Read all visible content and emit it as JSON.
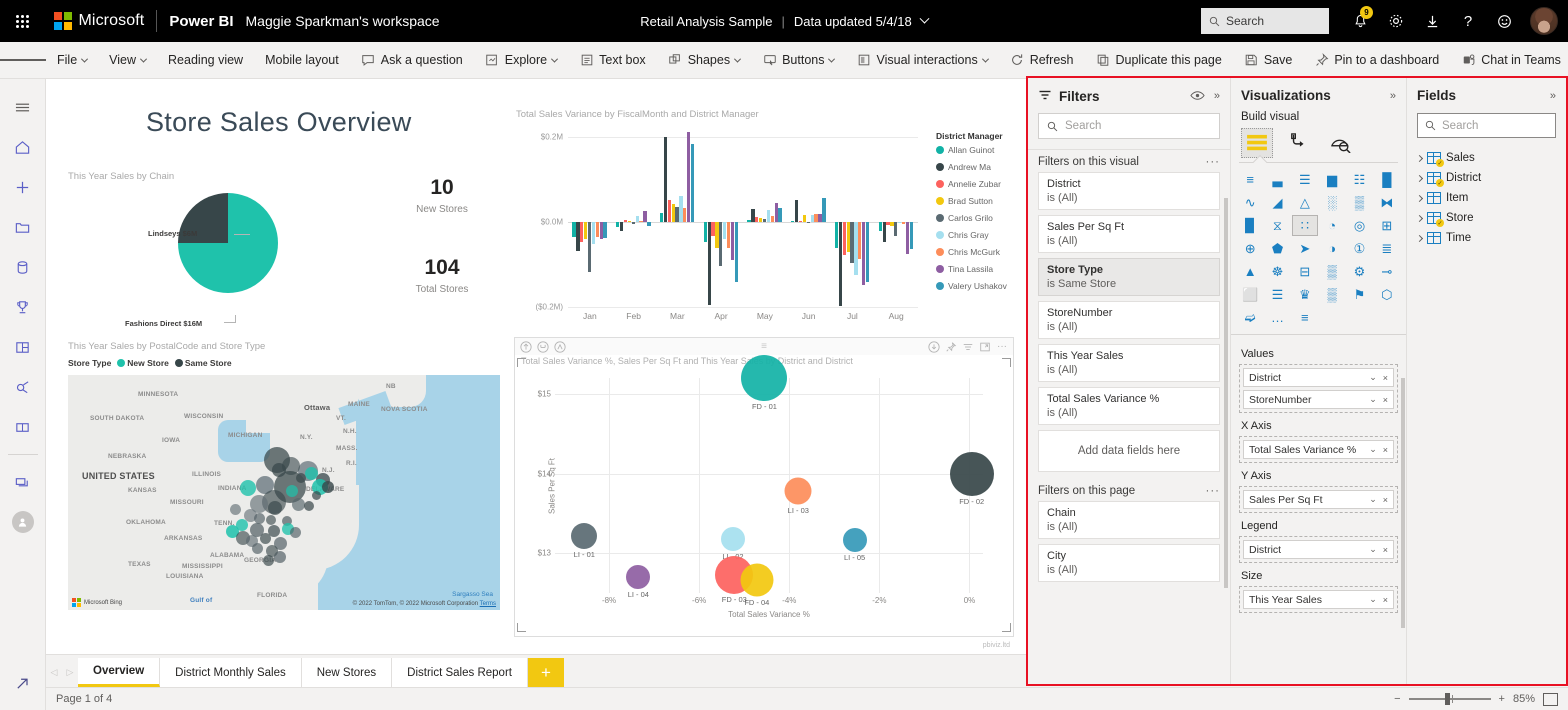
{
  "topbar": {
    "waffle": "app-launcher",
    "microsoft": "Microsoft",
    "product": "Power BI",
    "workspace": "Maggie Sparkman's workspace",
    "report_name": "Retail Analysis Sample",
    "separator": "|",
    "data_updated": "Data updated 5/4/18",
    "search_placeholder": "Search",
    "notification_count": "9",
    "icons": [
      "notifications-icon",
      "settings-icon",
      "download-icon",
      "help-icon",
      "feedback-icon",
      "avatar"
    ]
  },
  "commandbar": {
    "items": [
      {
        "label": "File",
        "icon": "",
        "caret": true
      },
      {
        "label": "View",
        "icon": "",
        "caret": true
      },
      {
        "label": "Reading view",
        "icon": "",
        "caret": false
      },
      {
        "label": "Mobile layout",
        "icon": "",
        "caret": false
      }
    ],
    "right_items": [
      {
        "label": "Ask a question",
        "icon": "chat-icon",
        "caret": false
      },
      {
        "label": "Explore",
        "icon": "explore-icon",
        "caret": true
      },
      {
        "label": "Text box",
        "icon": "textbox-icon",
        "caret": false
      },
      {
        "label": "Shapes",
        "icon": "shapes-icon",
        "caret": true
      },
      {
        "label": "Buttons",
        "icon": "buttons-icon",
        "caret": true
      },
      {
        "label": "Visual interactions",
        "icon": "interactions-icon",
        "caret": true
      },
      {
        "label": "Refresh",
        "icon": "refresh-icon",
        "caret": false
      },
      {
        "label": "Duplicate this page",
        "icon": "duplicate-icon",
        "caret": false
      },
      {
        "label": "Save",
        "icon": "save-icon",
        "caret": false
      },
      {
        "label": "Pin to a dashboard",
        "icon": "pin-icon",
        "caret": false
      },
      {
        "label": "Chat in Teams",
        "icon": "teams-icon",
        "caret": false
      },
      {
        "label": "···",
        "icon": "",
        "caret": false
      }
    ]
  },
  "rail": {
    "items": [
      "hamburger-icon",
      "home-icon",
      "create-icon",
      "browse-icon",
      "datahub-icon",
      "metrics-icon",
      "apps-icon",
      "deployment-pipelines-icon",
      "learn-icon",
      "workspaces-icon",
      "my-workspace-icon"
    ],
    "bottom": "open-in-new-icon"
  },
  "report": {
    "title": "Store Sales Overview",
    "pie": {
      "title": "This Year Sales by Chain",
      "labels": [
        "Lindseys $6M",
        "Fashions Direct $16M"
      ],
      "colors": [
        "#374649",
        "#1fc2ab"
      ]
    },
    "kpis": [
      {
        "value": "10",
        "label": "New Stores"
      },
      {
        "value": "104",
        "label": "Total Stores"
      }
    ],
    "map": {
      "title": "This Year Sales by PostalCode and Store Type",
      "legend_title": "Store Type",
      "legend": [
        {
          "label": "New Store",
          "color": "#1fc2ab"
        },
        {
          "label": "Same Store",
          "color": "#374649"
        }
      ],
      "country_label": "UNITED STATES",
      "state_labels": [
        "MINNESOTA",
        "WISCONSIN",
        "SOUTH DAKOTA",
        "MICHIGAN",
        "IOWA",
        "NEBRASKA",
        "ILLINOIS",
        "INDIANA",
        "KANSAS",
        "MISSOURI",
        "OKLAHOMA",
        "ARKANSAS",
        "TENN.",
        "ALABAMA",
        "MISSISSIPPI",
        "LOUISIANA",
        "TEXAS",
        "GEORGIA",
        "FLORIDA",
        "Ottawa",
        "MAINE",
        "NOVA SCOTIA",
        "NB",
        "VT.",
        "N.H.",
        "N.Y.",
        "MASS.",
        "R.I.",
        "N.J.",
        "DELAWARE",
        "Gulf of"
      ],
      "sea_label": "Sargasso Sea",
      "provider": "Microsoft Bing",
      "attribution": "© 2022 TomTom, © 2022 Microsoft Corporation",
      "terms": "Terms"
    }
  },
  "chart_data": [
    {
      "type": "bar",
      "title": "Total Sales Variance by FiscalMonth and District Manager",
      "xlabel": "",
      "ylabel": "",
      "categories": [
        "Jan",
        "Feb",
        "Mar",
        "Apr",
        "May",
        "Jun",
        "Jul",
        "Aug"
      ],
      "ytick_labels": [
        "$0.2M",
        "$0.0M",
        "($0.2M)"
      ],
      "ylim": [
        -0.2,
        0.2
      ],
      "legend_title": "District Manager",
      "legend_position": "right",
      "series": [
        {
          "name": "Allan Guinot",
          "color": "#12b2a6",
          "values": [
            -0.035,
            -0.012,
            0.022,
            -0.048,
            0.004,
            0.003,
            -0.06,
            -0.022
          ]
        },
        {
          "name": "Andrew Ma",
          "color": "#374649",
          "values": [
            -0.068,
            -0.02,
            0.2,
            -0.196,
            0.03,
            0.052,
            -0.197,
            -0.048
          ]
        },
        {
          "name": "Annelie Zubar",
          "color": "#fd625e",
          "values": [
            -0.046,
            0.005,
            0.052,
            -0.032,
            0.012,
            0.001,
            -0.078,
            -0.007
          ]
        },
        {
          "name": "Brad Sutton",
          "color": "#f2c80f",
          "values": [
            -0.04,
            0.001,
            0.042,
            -0.06,
            0.01,
            0.016,
            -0.07,
            -0.01
          ]
        },
        {
          "name": "Carlos Grilo",
          "color": "#5a6a72",
          "values": [
            -0.118,
            -0.004,
            0.036,
            -0.104,
            0.006,
            -0.003,
            -0.096,
            -0.033
          ]
        },
        {
          "name": "Chris Gray",
          "color": "#a5dfef",
          "values": [
            -0.052,
            0.014,
            0.062,
            -0.04,
            0.028,
            0.016,
            -0.124,
            -0.003
          ]
        },
        {
          "name": "Chris McGurk",
          "color": "#fd8d5a",
          "values": [
            -0.036,
            0.002,
            0.034,
            -0.062,
            0.014,
            0.018,
            -0.086,
            -0.004
          ]
        },
        {
          "name": "Tina Lassila",
          "color": "#8e5ea2",
          "values": [
            -0.04,
            0.026,
            0.212,
            -0.09,
            0.044,
            0.02,
            -0.148,
            -0.076
          ]
        },
        {
          "name": "Valery Ushakov",
          "color": "#3599b8",
          "values": [
            -0.038,
            -0.01,
            0.184,
            -0.142,
            0.032,
            0.056,
            -0.14,
            -0.064
          ]
        }
      ]
    },
    {
      "type": "scatter",
      "title": "Total Sales Variance %, Sales Per Sq Ft and This Year Sales by District and District",
      "xlabel": "Total Sales Variance %",
      "ylabel": "Sales Per Sq Ft",
      "xtick_labels": [
        "-8%",
        "-6%",
        "-4%",
        "-2%",
        "0%"
      ],
      "ytick_labels": [
        "$15",
        "$14",
        "$13"
      ],
      "xlim": [
        -9.2,
        0.3
      ],
      "ylim": [
        12.5,
        15.2
      ],
      "points": [
        {
          "label": "FD - 01",
          "x": -4.55,
          "y": 15.2,
          "size": 46,
          "color": "#12b2a6"
        },
        {
          "label": "FD - 02",
          "x": 0.05,
          "y": 14.0,
          "size": 44,
          "color": "#374649"
        },
        {
          "label": "LI - 03",
          "x": -3.8,
          "y": 13.78,
          "size": 27,
          "color": "#fd8d5a"
        },
        {
          "label": "LI - 01",
          "x": -8.55,
          "y": 13.22,
          "size": 26,
          "color": "#5a6a72"
        },
        {
          "label": "LI - 02",
          "x": -5.25,
          "y": 13.18,
          "size": 24,
          "color": "#a5dfef"
        },
        {
          "label": "LI - 05",
          "x": -2.55,
          "y": 13.16,
          "size": 24,
          "color": "#3599b8"
        },
        {
          "label": "LI - 04",
          "x": -7.35,
          "y": 12.7,
          "size": 24,
          "color": "#8e5ea2"
        },
        {
          "label": "FD - 03",
          "x": -5.22,
          "y": 12.73,
          "size": 38,
          "color": "#fd625e"
        },
        {
          "label": "FD - 04",
          "x": -4.72,
          "y": 12.66,
          "size": 33,
          "color": "#f2c80f"
        }
      ],
      "header_icons": [
        "drill-up-icon",
        "drill-down-icon",
        "expand-hierarchy-icon"
      ],
      "header_right_icons": [
        "download-icon",
        "pin-icon",
        "filter-icon",
        "focus-mode-icon",
        "more-options-icon"
      ],
      "watermark": "pbiviz.ltd"
    }
  ],
  "pagetabs": {
    "prev": "◁",
    "next": "▷",
    "tabs": [
      {
        "label": "Overview",
        "active": true
      },
      {
        "label": "District Monthly Sales",
        "active": false
      },
      {
        "label": "New Stores",
        "active": false
      },
      {
        "label": "District Sales Report",
        "active": false
      }
    ],
    "add": "+"
  },
  "statusbar": {
    "page_indicator": "Page 1 of 4",
    "zoom_out": "−",
    "zoom_in": "+",
    "zoom_level": "85%",
    "fit": "fit-to-page-icon"
  },
  "filters_pane": {
    "title": "Filters",
    "filter_icon": "filter-icon",
    "hide_icon": "eye-icon",
    "collapse_icon": "collapse-icon",
    "search_placeholder": "Search",
    "visual_section": "Filters on this visual",
    "visual_filters": [
      {
        "name": "District",
        "value": "is (All)",
        "selected": false
      },
      {
        "name": "Sales Per Sq Ft",
        "value": "is (All)",
        "selected": false
      },
      {
        "name": "Store Type",
        "value": "is Same Store",
        "selected": true
      },
      {
        "name": "StoreNumber",
        "value": "is (All)",
        "selected": false
      },
      {
        "name": "This Year Sales",
        "value": "is (All)",
        "selected": false
      },
      {
        "name": "Total Sales Variance %",
        "value": "is (All)",
        "selected": false
      }
    ],
    "drop_zone": "Add data fields here",
    "page_section": "Filters on this page",
    "page_filters": [
      {
        "name": "Chain",
        "value": "is (All)"
      },
      {
        "name": "City",
        "value": "is (All)"
      }
    ],
    "more": "···"
  },
  "viz_pane": {
    "title": "Visualizations",
    "collapse_icon": "collapse-icon",
    "build_label": "Build visual",
    "tabs": [
      {
        "name": "build-visual-tab",
        "active": true
      },
      {
        "name": "format-visual-tab",
        "active": false
      },
      {
        "name": "analytics-tab",
        "active": false
      }
    ],
    "visual_types": [
      "stacked-bar-chart",
      "stacked-column-chart",
      "clustered-bar-chart",
      "clustered-column-chart",
      "100-stacked-bar-chart",
      "100-stacked-column-chart",
      "line-chart",
      "area-chart",
      "stacked-area-chart",
      "line-and-stacked-column-chart",
      "line-and-clustered-column-chart",
      "ribbon-chart",
      "waterfall-chart",
      "funnel-chart",
      "scatter-chart",
      "pie-chart",
      "donut-chart",
      "treemap",
      "map",
      "filled-map",
      "azure-map",
      "shape-map",
      "gauge",
      "card",
      "multi-row-card",
      "kpi",
      "slicer",
      "table",
      "matrix",
      "r-script-visual",
      "decomposition-tree",
      "q-and-a",
      "paginated-report",
      "key-influencers",
      "narrative",
      "arcgis-map",
      "power-apps",
      "power-automate",
      "more-visuals"
    ],
    "active_visual": "scatter-chart",
    "wells": [
      {
        "label": "Values",
        "fields": [
          "District",
          "StoreNumber"
        ]
      },
      {
        "label": "X Axis",
        "fields": [
          "Total Sales Variance %"
        ]
      },
      {
        "label": "Y Axis",
        "fields": [
          "Sales Per Sq Ft"
        ]
      },
      {
        "label": "Legend",
        "fields": [
          "District"
        ]
      },
      {
        "label": "Size",
        "fields": [
          "This Year Sales"
        ]
      }
    ]
  },
  "fields_pane": {
    "title": "Fields",
    "collapse_icon": "collapse-icon",
    "search_placeholder": "Search",
    "tables": [
      {
        "name": "Sales",
        "has_measure": true
      },
      {
        "name": "District",
        "has_measure": true
      },
      {
        "name": "Item",
        "has_measure": false
      },
      {
        "name": "Store",
        "has_measure": true
      },
      {
        "name": "Time",
        "has_measure": false
      }
    ]
  }
}
